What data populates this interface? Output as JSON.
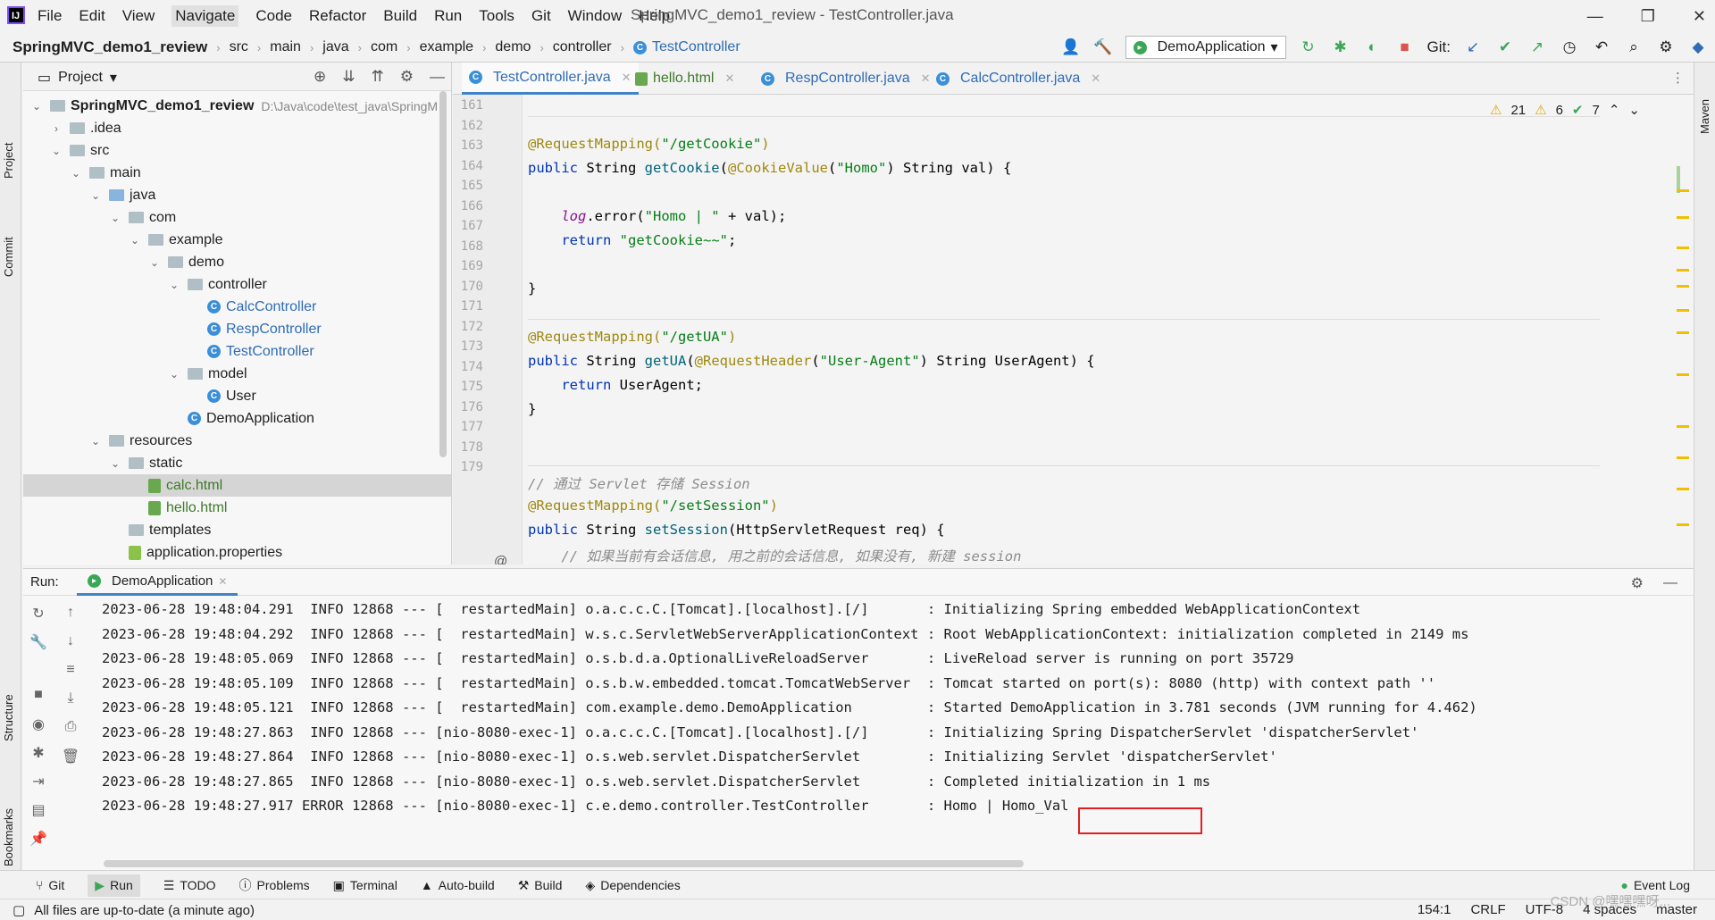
{
  "menu": {
    "items": [
      "File",
      "Edit",
      "View",
      "Navigate",
      "Code",
      "Refactor",
      "Build",
      "Run",
      "Tools",
      "Git",
      "Window",
      "Help"
    ],
    "window_title": "SpringMVC_demo1_review - TestController.java",
    "controls": [
      "—",
      "❐",
      "✕"
    ]
  },
  "breadcrumb": [
    "SpringMVC_demo1_review",
    "src",
    "main",
    "java",
    "com",
    "example",
    "demo",
    "controller",
    "TestController"
  ],
  "toolbar": {
    "run_config": "DemoApplication",
    "git_label": "Git:"
  },
  "left_strip": [
    "Project",
    "Commit",
    "Structure",
    "Bookmarks"
  ],
  "right_strip": [
    "Maven"
  ],
  "project": {
    "title": "Project",
    "root_path": "D:\\Java\\code\\test_java\\SpringM",
    "tree": [
      {
        "label": "SpringMVC_demo1_review",
        "indent": 0,
        "chev": "⌄",
        "icon": "folder"
      },
      {
        "label": ".idea",
        "indent": 1,
        "chev": "›",
        "icon": "folder"
      },
      {
        "label": "src",
        "indent": 1,
        "chev": "⌄",
        "icon": "folder"
      },
      {
        "label": "main",
        "indent": 2,
        "chev": "⌄",
        "icon": "folder"
      },
      {
        "label": "java",
        "indent": 3,
        "chev": "⌄",
        "icon": "folder-blue"
      },
      {
        "label": "com",
        "indent": 4,
        "chev": "⌄",
        "icon": "folder"
      },
      {
        "label": "example",
        "indent": 5,
        "chev": "⌄",
        "icon": "folder"
      },
      {
        "label": "demo",
        "indent": 6,
        "chev": "⌄",
        "icon": "folder"
      },
      {
        "label": "controller",
        "indent": 7,
        "chev": "⌄",
        "icon": "folder"
      },
      {
        "label": "CalcController",
        "indent": 8,
        "chev": "",
        "icon": "class"
      },
      {
        "label": "RespController",
        "indent": 8,
        "chev": "",
        "icon": "class"
      },
      {
        "label": "TestController",
        "indent": 8,
        "chev": "",
        "icon": "class"
      },
      {
        "label": "model",
        "indent": 7,
        "chev": "⌄",
        "icon": "folder"
      },
      {
        "label": "User",
        "indent": 8,
        "chev": "",
        "icon": "class-plain"
      },
      {
        "label": "DemoApplication",
        "indent": 7,
        "chev": "",
        "icon": "class-plain"
      },
      {
        "label": "resources",
        "indent": 3,
        "chev": "⌄",
        "icon": "folder"
      },
      {
        "label": "static",
        "indent": 4,
        "chev": "⌄",
        "icon": "folder"
      },
      {
        "label": "calc.html",
        "indent": 5,
        "chev": "",
        "icon": "html",
        "selected": true
      },
      {
        "label": "hello.html",
        "indent": 5,
        "chev": "",
        "icon": "html"
      },
      {
        "label": "templates",
        "indent": 4,
        "chev": "",
        "icon": "folder"
      },
      {
        "label": "application.properties",
        "indent": 4,
        "chev": "",
        "icon": "props"
      }
    ]
  },
  "editor": {
    "tabs": [
      {
        "label": "TestController.java",
        "icon": "class",
        "active": true
      },
      {
        "label": "hello.html",
        "icon": "html"
      },
      {
        "label": "RespController.java",
        "icon": "class"
      },
      {
        "label": "CalcController.java",
        "icon": "class"
      }
    ],
    "inspections": {
      "warnings": "21",
      "weak": "6",
      "ok": "7"
    },
    "line_numbers": [
      "161",
      "162",
      "163",
      "164",
      "165",
      "166",
      "167",
      "168",
      "169",
      "170",
      "171",
      "172",
      "173",
      "174",
      "175",
      "176",
      "177",
      "178",
      "179"
    ],
    "gutter_at": "@"
  },
  "run": {
    "label": "Run:",
    "tab": "DemoApplication",
    "log": [
      "2023-06-28 19:48:04.291  INFO 12868 --- [  restartedMain] o.a.c.c.C.[Tomcat].[localhost].[/]       : Initializing Spring embedded WebApplicationContext",
      "2023-06-28 19:48:04.292  INFO 12868 --- [  restartedMain] w.s.c.ServletWebServerApplicationContext : Root WebApplicationContext: initialization completed in 2149 ms",
      "2023-06-28 19:48:05.069  INFO 12868 --- [  restartedMain] o.s.b.d.a.OptionalLiveReloadServer       : LiveReload server is running on port 35729",
      "2023-06-28 19:48:05.109  INFO 12868 --- [  restartedMain] o.s.b.w.embedded.tomcat.TomcatWebServer  : Tomcat started on port(s): 8080 (http) with context path ''",
      "2023-06-28 19:48:05.121  INFO 12868 --- [  restartedMain] com.example.demo.DemoApplication         : Started DemoApplication in 3.781 seconds (JVM running for 4.462)",
      "2023-06-28 19:48:27.863  INFO 12868 --- [nio-8080-exec-1] o.a.c.c.C.[Tomcat].[localhost].[/]       : Initializing Spring DispatcherServlet 'dispatcherServlet'",
      "2023-06-28 19:48:27.864  INFO 12868 --- [nio-8080-exec-1] o.s.web.servlet.DispatcherServlet        : Initializing Servlet 'dispatcherServlet'",
      "2023-06-28 19:48:27.865  INFO 12868 --- [nio-8080-exec-1] o.s.web.servlet.DispatcherServlet        : Completed initialization in 1 ms",
      "2023-06-28 19:48:27.917 ERROR 12868 --- [nio-8080-exec-1] c.e.demo.controller.TestController       : Homo | Homo_Val"
    ]
  },
  "bottom_tabs": [
    "Git",
    "Run",
    "TODO",
    "Problems",
    "Terminal",
    "Auto-build",
    "Build",
    "Dependencies"
  ],
  "event_log": "Event Log",
  "status": {
    "message": "All files are up-to-date (a minute ago)",
    "position": "154:1",
    "line_sep": "CRLF",
    "encoding": "UTF-8",
    "indent": "4 spaces",
    "branch": "master"
  },
  "watermark": "CSDN @嘿嘿嘿呀..."
}
